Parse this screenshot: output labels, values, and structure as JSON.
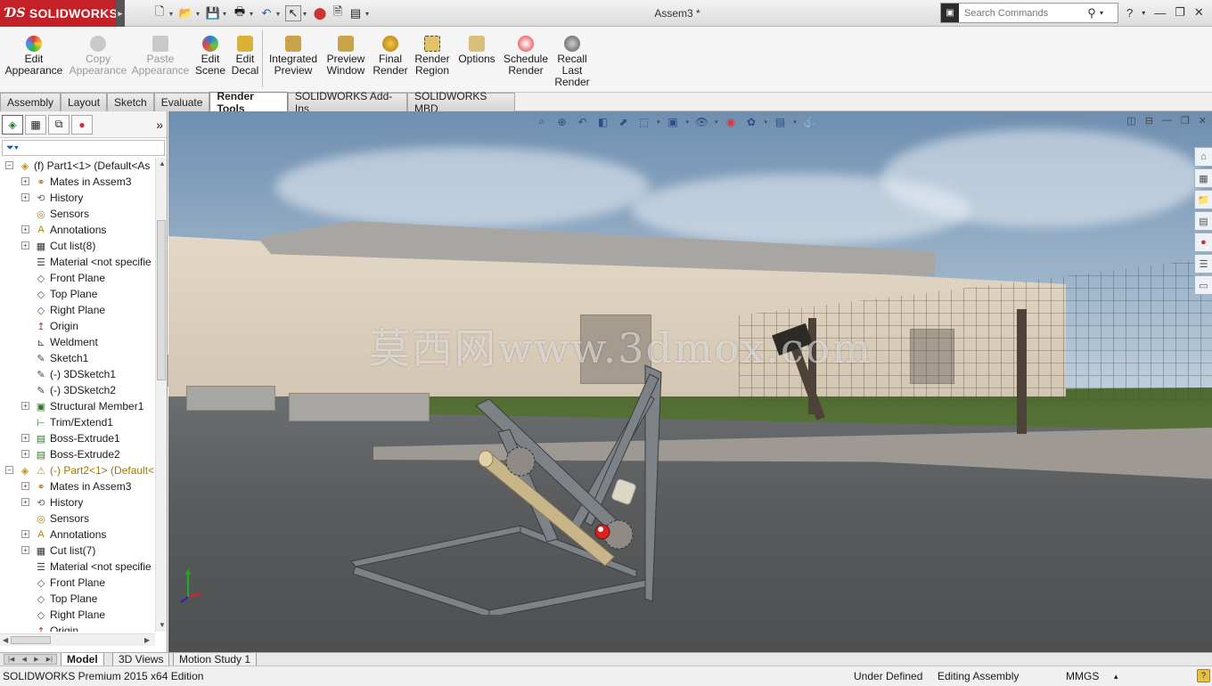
{
  "app": {
    "brand": "SOLIDWORKS",
    "doc_title": "Assem3 *"
  },
  "search": {
    "placeholder": "Search Commands"
  },
  "command_manager": {
    "items": [
      {
        "label": "Edit\nAppearance",
        "icon": "appearance-icon",
        "enabled": true
      },
      {
        "label": "Copy\nAppearance",
        "icon": "copy-appearance-icon",
        "enabled": false
      },
      {
        "label": "Paste\nAppearance",
        "icon": "paste-appearance-icon",
        "enabled": false
      },
      {
        "label": "Edit\nScene",
        "icon": "scene-icon",
        "enabled": true
      },
      {
        "label": "Edit\nDecal",
        "icon": "decal-icon",
        "enabled": true
      },
      {
        "label": "Integrated\nPreview",
        "icon": "integrated-preview-icon",
        "enabled": true
      },
      {
        "label": "Preview\nWindow",
        "icon": "preview-window-icon",
        "enabled": true
      },
      {
        "label": "Final\nRender",
        "icon": "final-render-icon",
        "enabled": true
      },
      {
        "label": "Render\nRegion",
        "icon": "render-region-icon",
        "enabled": true
      },
      {
        "label": "Options",
        "icon": "options-icon",
        "enabled": true
      },
      {
        "label": "Schedule\nRender",
        "icon": "schedule-render-icon",
        "enabled": true
      },
      {
        "label": "Recall\nLast\nRender",
        "icon": "recall-render-icon",
        "enabled": true
      }
    ]
  },
  "tabs": {
    "items": [
      "Assembly",
      "Layout",
      "Sketch",
      "Evaluate",
      "Render Tools",
      "SOLIDWORKS Add-Ins",
      "SOLIDWORKS MBD"
    ],
    "active": "Render Tools"
  },
  "tree": {
    "nodes": [
      {
        "label": "(f) Part1<1> (Default<As",
        "icon": "part-icon",
        "level": 0,
        "expander": "minus"
      },
      {
        "label": "Mates in Assem3",
        "icon": "mates-icon",
        "level": 1,
        "expander": "plus"
      },
      {
        "label": "History",
        "icon": "history-icon",
        "level": 1,
        "expander": "plus"
      },
      {
        "label": "Sensors",
        "icon": "sensors-icon",
        "level": 1,
        "expander": ""
      },
      {
        "label": "Annotations",
        "icon": "annotations-icon",
        "level": 1,
        "expander": "plus"
      },
      {
        "label": "Cut list(8)",
        "icon": "cut-list-icon",
        "level": 1,
        "expander": "plus"
      },
      {
        "label": "Material <not specifie",
        "icon": "material-icon",
        "level": 1,
        "expander": ""
      },
      {
        "label": "Front Plane",
        "icon": "plane-icon",
        "level": 1,
        "expander": ""
      },
      {
        "label": "Top Plane",
        "icon": "plane-icon",
        "level": 1,
        "expander": ""
      },
      {
        "label": "Right Plane",
        "icon": "plane-icon",
        "level": 1,
        "expander": ""
      },
      {
        "label": "Origin",
        "icon": "origin-icon",
        "level": 1,
        "expander": ""
      },
      {
        "label": "Weldment",
        "icon": "weldment-icon",
        "level": 1,
        "expander": ""
      },
      {
        "label": "Sketch1",
        "icon": "sketch-icon",
        "level": 1,
        "expander": ""
      },
      {
        "label": "(-) 3DSketch1",
        "icon": "3dsketch-icon",
        "level": 1,
        "expander": ""
      },
      {
        "label": "(-) 3DSketch2",
        "icon": "3dsketch-icon",
        "level": 1,
        "expander": ""
      },
      {
        "label": "Structural Member1",
        "icon": "structural-member-icon",
        "level": 1,
        "expander": "plus"
      },
      {
        "label": "Trim/Extend1",
        "icon": "trim-extend-icon",
        "level": 1,
        "expander": ""
      },
      {
        "label": "Boss-Extrude1",
        "icon": "boss-extrude-icon",
        "level": 1,
        "expander": "plus"
      },
      {
        "label": "Boss-Extrude2",
        "icon": "boss-extrude-icon",
        "level": 1,
        "expander": "plus"
      },
      {
        "label": "(-) Part2<1> (Default<",
        "icon": "part-icon",
        "level": 0,
        "expander": "minus",
        "warning": true
      },
      {
        "label": "Mates in Assem3",
        "icon": "mates-icon",
        "level": 1,
        "expander": "plus"
      },
      {
        "label": "History",
        "icon": "history-icon",
        "level": 1,
        "expander": "plus"
      },
      {
        "label": "Sensors",
        "icon": "sensors-icon",
        "level": 1,
        "expander": ""
      },
      {
        "label": "Annotations",
        "icon": "annotations-icon",
        "level": 1,
        "expander": "plus"
      },
      {
        "label": "Cut list(7)",
        "icon": "cut-list-icon",
        "level": 1,
        "expander": "plus"
      },
      {
        "label": "Material <not specifie",
        "icon": "material-icon",
        "level": 1,
        "expander": ""
      },
      {
        "label": "Front Plane",
        "icon": "plane-icon",
        "level": 1,
        "expander": ""
      },
      {
        "label": "Top Plane",
        "icon": "plane-icon",
        "level": 1,
        "expander": ""
      },
      {
        "label": "Right Plane",
        "icon": "plane-icon",
        "level": 1,
        "expander": ""
      },
      {
        "label": "Origin",
        "icon": "origin-icon",
        "level": 1,
        "expander": ""
      }
    ]
  },
  "viewport": {
    "watermark": "莫西网www.3dmox.com"
  },
  "bottom_tabs": {
    "items": [
      "Model",
      "3D Views",
      "Motion Study 1"
    ],
    "active": "Model"
  },
  "status": {
    "edition": "SOLIDWORKS Premium 2015 x64 Edition",
    "definition": "Under Defined",
    "mode": "Editing Assembly",
    "units": "MMGS",
    "units_arrow": "▴"
  },
  "colors": {
    "brand_red": "#c42027",
    "warning": "#9b7a00"
  }
}
